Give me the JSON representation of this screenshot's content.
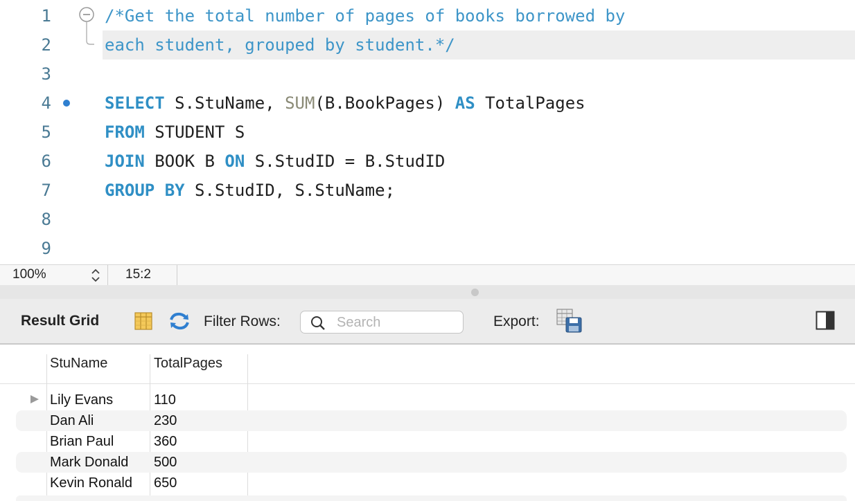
{
  "editor": {
    "line_numbers": [
      "1",
      "2",
      "3",
      "4",
      "5",
      "6",
      "7",
      "8",
      "9"
    ],
    "lines": {
      "l1": {
        "comment": "/*Get the total number of pages of books borrowed by"
      },
      "l2": {
        "comment": "each student, grouped by student.*/"
      },
      "l4": {
        "kw_select": "SELECT",
        "t1": " S.StuName, ",
        "fn_sum": "SUM",
        "t2": "(B.BookPages) ",
        "kw_as": "AS",
        "t3": " TotalPages"
      },
      "l5": {
        "kw_from": "FROM",
        "t1": " STUDENT S"
      },
      "l6": {
        "kw_join": "JOIN",
        "t1": " BOOK B ",
        "kw_on": "ON",
        "t2": " S.StudID = B.StudID"
      },
      "l7": {
        "kw_group": "GROUP BY",
        "t1": " S.StudID, S.StuName;"
      }
    }
  },
  "statusbar": {
    "zoom": "100%",
    "cursor_position": "15:2"
  },
  "result_toolbar": {
    "title": "Result Grid",
    "filter_label": "Filter Rows:",
    "search_placeholder": "Search",
    "export_label": "Export:"
  },
  "result_grid": {
    "columns": [
      "StuName",
      "TotalPages"
    ],
    "rows": [
      {
        "StuName": "Lily Evans",
        "TotalPages": "110"
      },
      {
        "StuName": "Dan Ali",
        "TotalPages": "230"
      },
      {
        "StuName": "Brian Paul",
        "TotalPages": "360"
      },
      {
        "StuName": "Mark Donald",
        "TotalPages": "500"
      },
      {
        "StuName": "Kevin Ronald",
        "TotalPages": "650"
      }
    ]
  },
  "colors": {
    "keyword": "#2f8fc5",
    "comment": "#3d95c8",
    "function": "#8a8a76",
    "line_number": "#4a7a94"
  }
}
